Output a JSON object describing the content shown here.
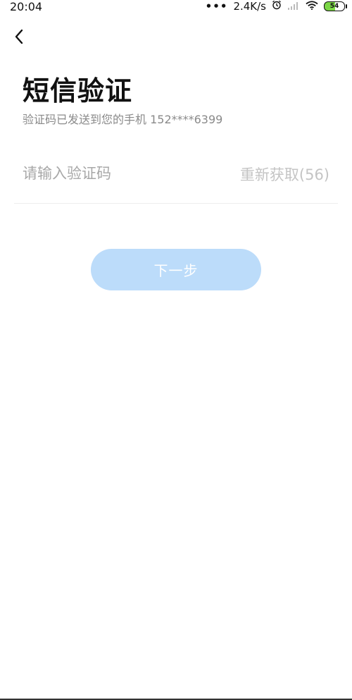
{
  "status_bar": {
    "time": "20:04",
    "dots": "•••",
    "network_speed": "2.4K/s",
    "battery_level": "54"
  },
  "icons": {
    "back": "chevron-left-icon",
    "alarm": "alarm-clock-icon",
    "signal": "signal-bars-icon",
    "wifi": "wifi-icon",
    "battery": "battery-icon"
  },
  "page": {
    "title": "短信验证",
    "subtitle": "验证码已发送到您的手机 152****6399"
  },
  "form": {
    "code_placeholder": "请输入验证码",
    "code_value": "",
    "resend_label": "重新获取(56)"
  },
  "actions": {
    "next_label": "下一步"
  },
  "colors": {
    "button_bg": "#bcdcfa",
    "button_text": "#ffffff",
    "placeholder": "#a8a8a8",
    "resend_text": "#c4c4c4",
    "subtitle": "#8a8a8a",
    "battery_fill": "#7bd646"
  }
}
